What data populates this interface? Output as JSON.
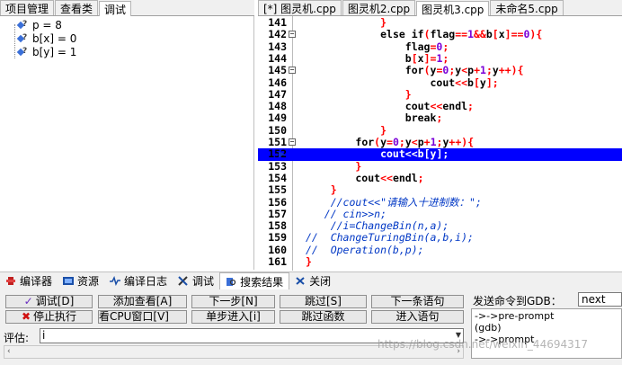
{
  "left_tabs": [
    "项目管理",
    "查看类",
    "调试"
  ],
  "editor_tabs": [
    "[*] 图灵机.cpp",
    "图灵机2.cpp",
    "图灵机3.cpp",
    "未命名5.cpp"
  ],
  "debug_vars": [
    "p = 8",
    "b[x] = 0",
    "b[y] = 1"
  ],
  "code_lines": [
    {
      "n": "141",
      "h": "            <span class='p'>}</span>"
    },
    {
      "n": "142",
      "h": "            <span class='k'>else if</span><span class='p'>(</span>flag<span class='p'>==</span><span class='n'>1</span><span class='p'>&amp;&amp;</span>b<span class='p'>[</span>x<span class='p'>]==</span><span class='n'>0</span><span class='p'>){</span>"
    },
    {
      "n": "143",
      "h": "                flag<span class='p'>=</span><span class='n'>0</span><span class='p'>;</span>"
    },
    {
      "n": "144",
      "h": "                b<span class='p'>[</span>x<span class='p'>]=</span><span class='n'>1</span><span class='p'>;</span>"
    },
    {
      "n": "145",
      "h": "                <span class='k'>for</span><span class='p'>(</span>y<span class='p'>=</span><span class='n'>0</span><span class='p'>;</span>y<span class='p'>&lt;</span>p<span class='p'>+</span><span class='n'>1</span><span class='p'>;</span>y<span class='p'>++){</span>"
    },
    {
      "n": "146",
      "h": "                    cout<span class='p'>&lt;&lt;</span>b<span class='p'>[</span>y<span class='p'>];</span>"
    },
    {
      "n": "147",
      "h": "                <span class='p'>}</span>"
    },
    {
      "n": "148",
      "h": "                cout<span class='p'>&lt;&lt;</span>endl<span class='p'>;</span>"
    },
    {
      "n": "149",
      "h": "                <span class='k'>break</span><span class='p'>;</span>"
    },
    {
      "n": "150",
      "h": "            <span class='p'>}</span>"
    },
    {
      "n": "151",
      "h": "        <span class='k'>for</span><span class='p'>(</span>y<span class='p'>=</span><span class='n'>0</span><span class='p'>;</span>y<span class='p'>&lt;</span>p<span class='p'>+</span><span class='n'>1</span><span class='p'>;</span>y<span class='p'>++){</span>"
    },
    {
      "n": "152",
      "h": "            cout<span class='p'>&lt;&lt;</span>b<span class='p'>[</span>y<span class='p'>];</span>",
      "hl": true
    },
    {
      "n": "153",
      "h": "        <span class='p'>}</span>"
    },
    {
      "n": "154",
      "h": "        cout<span class='p'>&lt;&lt;</span>endl<span class='p'>;</span>"
    },
    {
      "n": "155",
      "h": "    <span class='p'>}</span>"
    },
    {
      "n": "156",
      "h": "    <span class='cm'>//cout&lt;&lt;\"请输入十进制数：\";</span>"
    },
    {
      "n": "157",
      "h": "   <span class='cm'>// cin&gt;&gt;n;</span>"
    },
    {
      "n": "158",
      "h": "    <span class='cm'>//i=ChangeBin(n,a);</span>"
    },
    {
      "n": "159",
      "h": "<span class='cm'>//  ChangeTuringBin(a,b,i);</span>"
    },
    {
      "n": "160",
      "h": "<span class='cm'>//  Operation(b,p);</span>"
    },
    {
      "n": "161",
      "h": "<span class='p'>}</span>"
    }
  ],
  "bottom_tabs": [
    {
      "label": "编译器",
      "icon": "compiler-icon"
    },
    {
      "label": "资源",
      "icon": "resources-icon"
    },
    {
      "label": "编译日志",
      "icon": "compile-log-icon"
    },
    {
      "label": "调试",
      "icon": "debug-icon"
    },
    {
      "label": "搜索结果",
      "icon": "search-results-icon"
    },
    {
      "label": "关闭",
      "icon": "close-icon"
    }
  ],
  "buttons": {
    "debug": "调试[D]",
    "add_watch": "添加查看[A]",
    "next_step": "下一步[N]",
    "skip": "跳过[S]",
    "next_statement": "下一条语句",
    "stop": "停止执行",
    "cpu_window": "查看CPU窗口[V]",
    "step_into": "单步进入[i]",
    "skip_function": "跳过函数",
    "into_statement": "进入语句"
  },
  "gdb": {
    "label": "发送命令到GDB：",
    "input": "next",
    "output": [
      "->->pre-prompt",
      "(gdb)",
      "->->prompt"
    ]
  },
  "eval": {
    "label": "评估:",
    "value": "i"
  },
  "watermark": "https://blog.csdn.net/weixin_44694317"
}
